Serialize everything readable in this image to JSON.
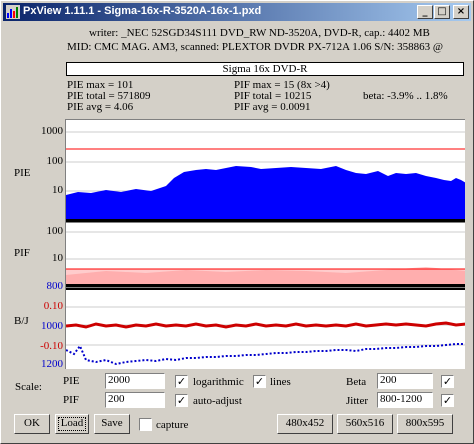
{
  "window": {
    "title": "PxView 1.11.1  -  Sigma-16x-R-3520A-16x-1.pxd",
    "buttons": {
      "minimize": "_",
      "maximize": "□",
      "close": "×"
    }
  },
  "info": {
    "writer_line": "writer: _NEC 52SGD34S111 DVD_RW ND-3520A, DVD-R, cap.: 4402 MB",
    "mid_line": "MID: CMC MAG. AM3, scanned: PLEXTOR DVDR PX-712A 1.06 S/N: 358863 @",
    "disc_name": "Sigma 16x DVD-R"
  },
  "stats": {
    "pie_max": "PIE max = 101",
    "pie_total": "PIE total = 571809",
    "pie_avg": "PIE avg = 4.06",
    "pif_max": "PIF max = 15 (8x >4)",
    "pif_total": "PIF total = 10215",
    "pif_avg": "PIF avg = 0.0091",
    "beta": "beta: -3.9% .. 1.8%"
  },
  "charts": {
    "pie": {
      "label": "PIE",
      "ticks": [
        "1000",
        "100",
        "10"
      ],
      "fill_color": "#0000ff",
      "limit_color": "#ff0000"
    },
    "pif": {
      "label": "PIF",
      "ticks": [
        "100",
        "10"
      ],
      "fill_color": "#ff9999"
    },
    "bj": {
      "label": "B/J",
      "left_ticks": [
        "800",
        "0.10",
        "1000",
        "-0.10",
        "1200"
      ],
      "beta_color": "#cc0000",
      "jitter_color": "#0000cc"
    }
  },
  "controls": {
    "scale_label": "Scale:",
    "pie_label": "PIE",
    "pie_scale": "2000",
    "pif_label": "PIF",
    "pif_scale": "200",
    "logarithmic": {
      "label": "logarithmic",
      "checked": "✓"
    },
    "lines": {
      "label": "lines",
      "checked": "✓"
    },
    "auto_adjust": {
      "label": "auto-adjust",
      "checked": "✓"
    },
    "beta_label": "Beta",
    "beta_value": "200",
    "beta_checked": "✓",
    "jitter_label": "Jitter",
    "jitter_value": "800-1200",
    "jitter_checked": "✓",
    "capture": {
      "label": "capture",
      "checked": ""
    }
  },
  "buttons": {
    "ok": "OK",
    "load": "Load",
    "save": "Save",
    "size1": "480x452",
    "size2": "560x516",
    "size3": "800x595"
  }
}
